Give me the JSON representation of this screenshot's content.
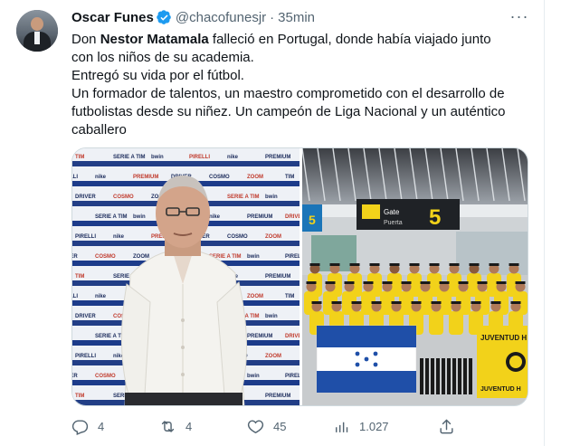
{
  "tweet": {
    "author_name": "Oscar Funes",
    "handle": "@chacofunesjr",
    "separator": "·",
    "time": "35min",
    "more_label": "···",
    "text": {
      "line1_prefix": "Don ",
      "line1_bold": "Nestor Matamala",
      "line1_suffix": " falleció en Portugal, donde había viajado junto",
      "line2": "con los niños de su academia.",
      "line3": "Entregó su vida por el fútbol.",
      "line4": "Un formador de talentos, un maestro comprometido con el desarrollo de",
      "line5": "futbolistas desde su niñez. Un campeón de Liga Nacional y un auténtico",
      "line6": "caballero"
    },
    "media": {
      "left_backdrop_words": [
        "TIM",
        "SERIE A TIM",
        "bwin",
        "PIRELLI",
        "nike",
        "PREMIUM",
        "DRIVER",
        "COSMO",
        "ZOOM"
      ],
      "right_sign_word": "Gate",
      "right_sign_subword": "Puerta",
      "right_gate_number": "5",
      "right_gate_number_left": "5",
      "banner_text_top": "JUVENTUD H",
      "banner_text_bottom": "JUVENTUD H"
    },
    "stats": {
      "replies": "4",
      "retweets": "4",
      "likes": "45",
      "views": "1.027"
    }
  },
  "colors": {
    "text": "#0f1419",
    "muted": "#536471",
    "verified": "#1d9bf0",
    "border": "#cfd9de",
    "jersey_yellow": "#f2d21a",
    "honduras_blue": "#1f4fa8"
  },
  "icons": [
    "verified-badge-icon",
    "more-icon",
    "reply-icon",
    "retweet-icon",
    "like-icon",
    "views-icon",
    "share-icon"
  ]
}
